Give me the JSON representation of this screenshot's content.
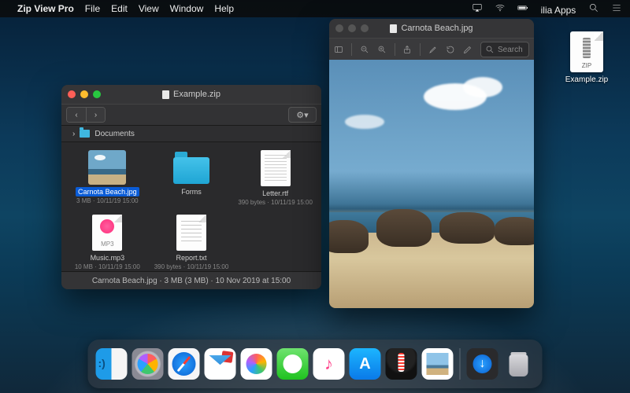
{
  "menubar": {
    "app_name": "Zip View Pro",
    "items": [
      "File",
      "Edit",
      "View",
      "Window",
      "Help"
    ],
    "user": "ilia Apps"
  },
  "desktop_file": {
    "ext": "ZIP",
    "name": "Example.zip"
  },
  "archive_window": {
    "title": "Example.zip",
    "path": "Documents",
    "files": [
      {
        "name": "Carnota Beach.jpg",
        "meta": "3 MB · 10/11/19 15:00",
        "kind": "img",
        "selected": true
      },
      {
        "name": "Forms",
        "meta": "",
        "kind": "folder",
        "selected": false
      },
      {
        "name": "Letter.rtf",
        "meta": "390 bytes · 10/11/19 15:00",
        "kind": "doc",
        "selected": false
      },
      {
        "name": "Music.mp3",
        "meta": "10 MB · 10/11/19 15:00",
        "kind": "mp3",
        "selected": false
      },
      {
        "name": "Report.txt",
        "meta": "390 bytes · 10/11/19 15:00",
        "kind": "txt",
        "selected": false
      }
    ],
    "status": "Carnota Beach.jpg · 3 MB (3 MB) · 10 Nov 2019 at 15:00"
  },
  "preview_window": {
    "title": "Carnota Beach.jpg",
    "search_placeholder": "Search"
  },
  "dock": {
    "apps": [
      "finder",
      "launchpad",
      "safari",
      "mail",
      "photos",
      "messages",
      "music",
      "appstore",
      "zip-view-pro",
      "preview"
    ],
    "right": [
      "downloads",
      "trash"
    ]
  }
}
